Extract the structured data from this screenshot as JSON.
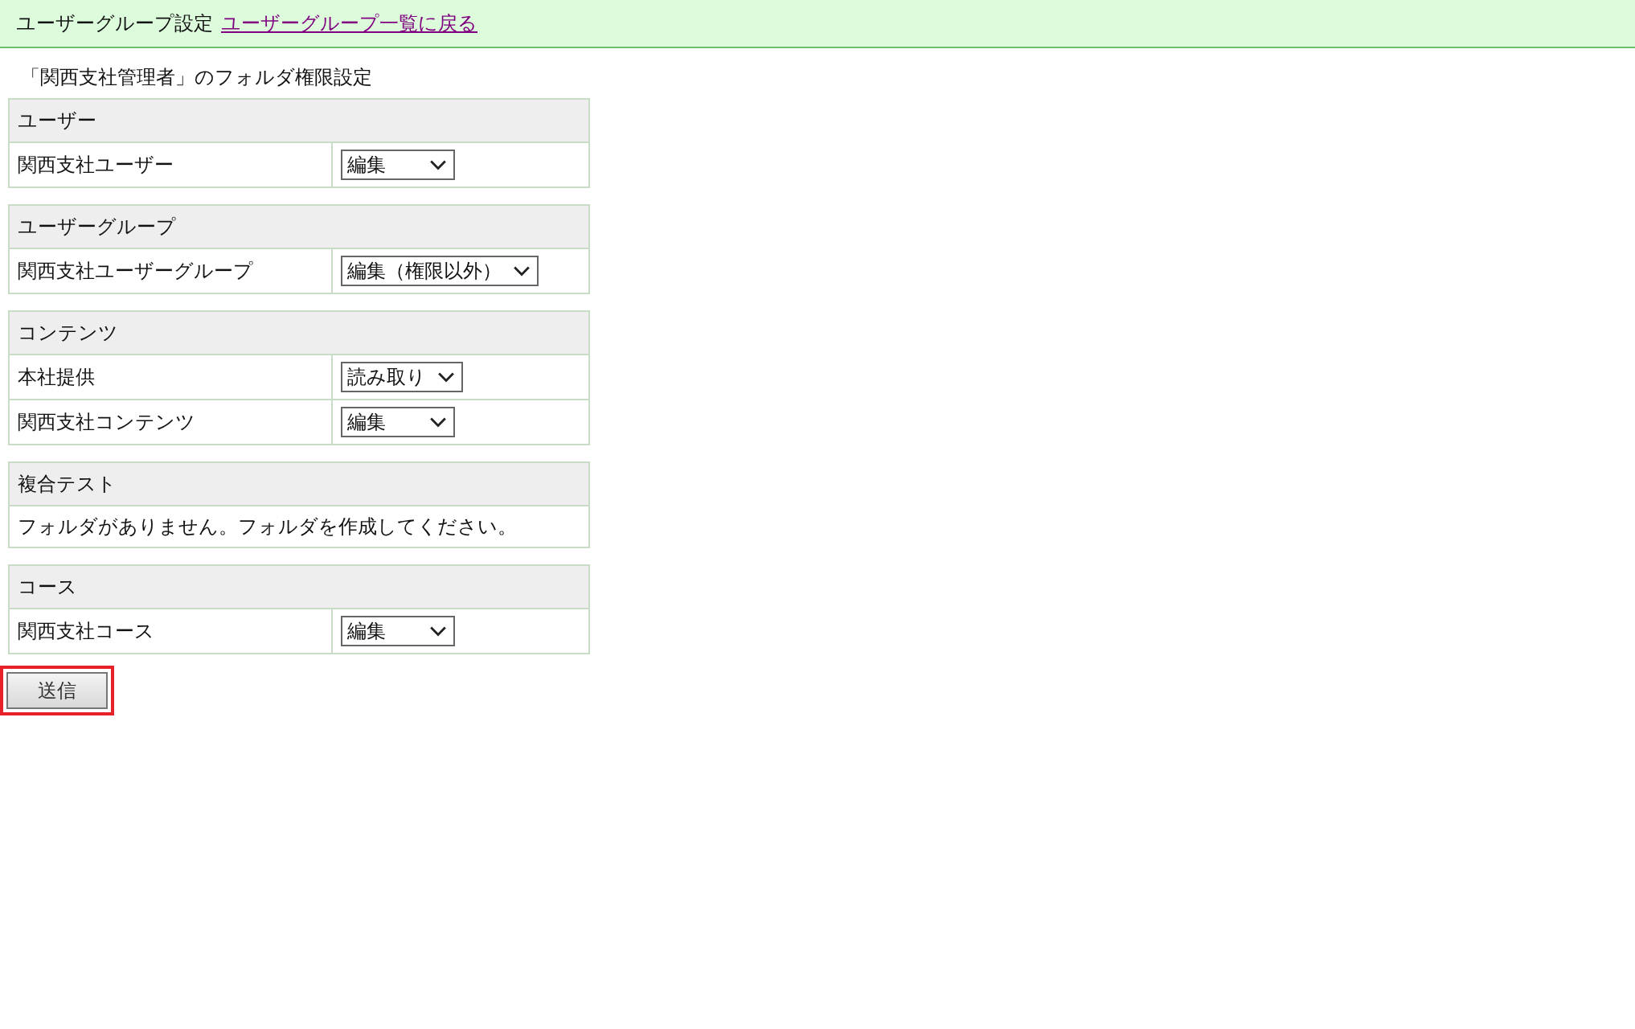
{
  "header": {
    "title": "ユーザーグループ設定",
    "back_link": "ユーザーグループ一覧に戻る"
  },
  "heading": "「関西支社管理者」のフォルダ権限設定",
  "sections": [
    {
      "title": "ユーザー",
      "rows": [
        {
          "kind": "folder",
          "name": "関西支社ユーザー",
          "permission": "編集"
        }
      ]
    },
    {
      "title": "ユーザーグループ",
      "rows": [
        {
          "kind": "folder",
          "name": "関西支社ユーザーグループ",
          "permission": "編集（権限以外）"
        }
      ]
    },
    {
      "title": "コンテンツ",
      "rows": [
        {
          "kind": "folder",
          "name": "本社提供",
          "permission": "読み取り"
        },
        {
          "kind": "folder",
          "name": "関西支社コンテンツ",
          "permission": "編集"
        }
      ]
    },
    {
      "title": "複合テスト",
      "rows": [
        {
          "kind": "message",
          "text": "フォルダがありません。フォルダを作成してください。"
        }
      ]
    },
    {
      "title": "コース",
      "rows": [
        {
          "kind": "folder",
          "name": "関西支社コース",
          "permission": "編集"
        }
      ]
    }
  ],
  "submit_button": {
    "label": "送信",
    "highlighted": true
  }
}
